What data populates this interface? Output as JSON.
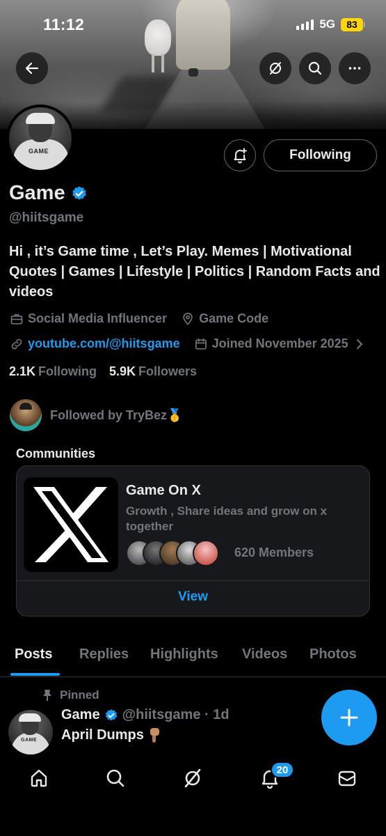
{
  "status_bar": {
    "time": "11:12",
    "network": "5G",
    "battery": "83"
  },
  "profile": {
    "name": "Game",
    "handle": "@hiitsgame",
    "bio": "Hi , it’s Game time , Let’s Play. Memes | Motivational Quotes | Games | Lifestyle | Politics | Random Facts and videos",
    "category": "Social Media Influencer",
    "location": "Game Code",
    "website": "youtube.com/@hiitsgame",
    "joined": "Joined November 2025",
    "following_count": "2.1K",
    "following_label": "Following",
    "followers_count": "5.9K",
    "followers_label": "Followers",
    "followed_by": "Followed by TryBez🥇",
    "avatar_shirt_text": "GAME"
  },
  "actions": {
    "following_button": "Following"
  },
  "communities": {
    "title": "Communities",
    "card": {
      "name": "Game On X",
      "description": "Growth , Share ideas and grow on x together",
      "members": "620 Members",
      "view": "View"
    }
  },
  "tabs": [
    "Posts",
    "Replies",
    "Highlights",
    "Videos",
    "Photos"
  ],
  "pinned_post": {
    "pinned_label": "Pinned",
    "author": "Game",
    "handle_time": "@hiitsgame · 1d",
    "text": "April Dumps"
  },
  "bottom_nav": {
    "notification_badge": "20"
  },
  "colors": {
    "accent": "#1d9bf0",
    "muted": "#71767b",
    "text": "#e7e9ea",
    "border": "#2f3336",
    "battery": "#ffd60a"
  },
  "icons": [
    "back-arrow-icon",
    "grok-icon",
    "search-icon",
    "more-icon",
    "bell-plus-icon",
    "verified-icon",
    "briefcase-icon",
    "location-pin-icon",
    "link-icon",
    "calendar-icon",
    "chevron-right-icon",
    "pin-icon",
    "plus-icon",
    "home-icon",
    "bell-icon",
    "mail-icon"
  ]
}
